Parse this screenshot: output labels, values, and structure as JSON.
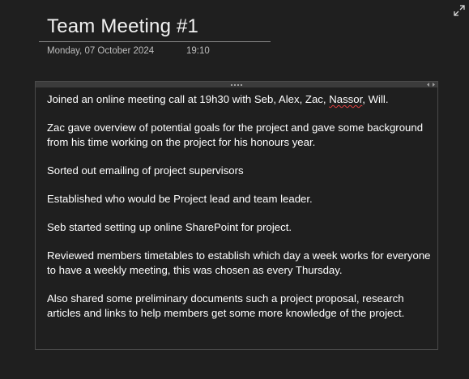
{
  "page": {
    "title": "Team Meeting #1",
    "date": "Monday, 07 October 2024",
    "time": "19:10"
  },
  "icons": {
    "expand": "expand-diagonal-icon",
    "grip": "drag-grip-icon",
    "resize": "resize-horizontal-icon"
  },
  "colors": {
    "background": "#1f1f1f",
    "text": "#ffffff",
    "meta_text": "#bdbdbd",
    "spellcheck_underline": "#e04040"
  },
  "note": {
    "line1_before": "Joined an online meeting call at 19h30 with Seb, Alex, Zac, ",
    "line1_flagged": "Nassor",
    "line1_after": ", Will.",
    "paragraphs": [
      "Zac gave overview of potential goals for the project and gave some background from his time working on the project for his honours year.",
      "Sorted out emailing of project supervisors",
      "Established who would be Project lead and team leader.",
      "Seb started setting up online SharePoint for project.",
      "Reviewed members timetables to establish which day a week works for everyone to have a weekly meeting, this was chosen as every Thursday.",
      "Also shared some preliminary documents such a project proposal, research articles and links to help members get some more knowledge of the project."
    ]
  }
}
